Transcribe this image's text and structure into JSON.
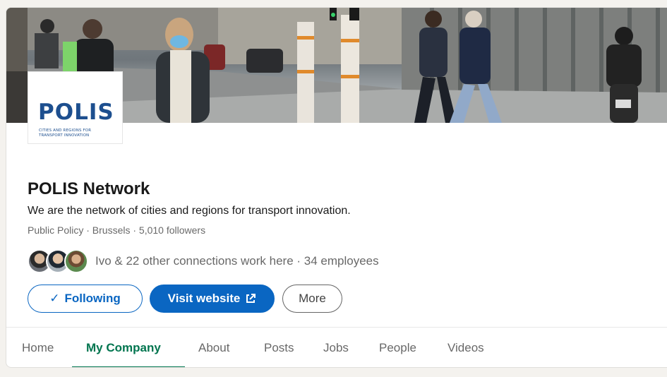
{
  "company": {
    "logo_word": "POLIS",
    "logo_tagline_line1": "CITIES AND REGIONS FOR",
    "logo_tagline_line2": "TRANSPORT INNOVATION",
    "name": "POLIS Network",
    "tagline": "We are the network of cities and regions for transport innovation.",
    "meta": "Public Policy · Brussels · 5,010 followers"
  },
  "connections": {
    "text": "Ivo & 22 other connections work here · 34 employees"
  },
  "actions": {
    "following_icon": "✓",
    "following_label": "Following",
    "visit_label": "Visit website",
    "visit_icon": "external-link-icon",
    "more_label": "More"
  },
  "tabs": [
    {
      "label": "Home"
    },
    {
      "label": "My Company"
    },
    {
      "label": "About"
    },
    {
      "label": "Posts"
    },
    {
      "label": "Jobs"
    },
    {
      "label": "People"
    },
    {
      "label": "Videos"
    }
  ],
  "colors": {
    "primary_blue": "#0a66c2",
    "active_tab_green": "#01754f",
    "logo_blue": "#1d4f8f"
  }
}
